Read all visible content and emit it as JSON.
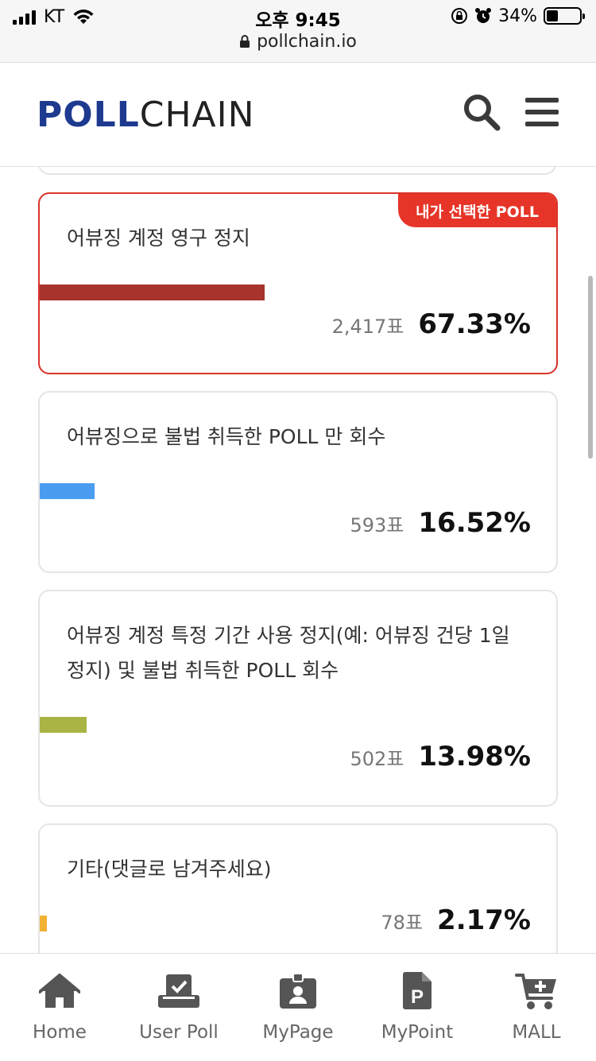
{
  "status_bar": {
    "carrier": "KT",
    "time": "오후 9:45",
    "battery": "34%",
    "battery_level": 0.34,
    "url": "pollchain.io"
  },
  "header": {
    "logo_part1": "POLL",
    "logo_part2": "CHAIN",
    "search_icon": "search-icon",
    "menu_icon": "hamburger-menu-icon"
  },
  "options": [
    {
      "text": "어뷰징 계정 영구 정지",
      "votes": "2,417표",
      "percent": "67.33%",
      "value": 67.33,
      "color": "#a8322c",
      "selected": true,
      "badge": "내가 선택한 POLL"
    },
    {
      "text": "어뷰징으로 불법 취득한 POLL 만 회수",
      "votes": "593표",
      "percent": "16.52%",
      "value": 16.52,
      "color": "#4a9cf0",
      "selected": false
    },
    {
      "text": "어뷰징 계정 특정 기간 사용 정지(예: 어뷰징 건당 1일 정지) 및 불법 취득한 POLL 회수",
      "votes": "502표",
      "percent": "13.98%",
      "value": 13.98,
      "color": "#a9b444",
      "selected": false
    },
    {
      "text": "기타(댓글로 남겨주세요)",
      "votes": "78표",
      "percent": "2.17%",
      "value": 2.17,
      "color": "#f2b234",
      "selected": false
    }
  ],
  "bottom_nav": [
    {
      "label": "Home",
      "icon": "home-icon"
    },
    {
      "label": "User Poll",
      "icon": "ballot-box-icon"
    },
    {
      "label": "MyPage",
      "icon": "id-badge-icon"
    },
    {
      "label": "MyPoint",
      "icon": "point-document-icon"
    },
    {
      "label": "MALL",
      "icon": "cart-icon"
    }
  ]
}
